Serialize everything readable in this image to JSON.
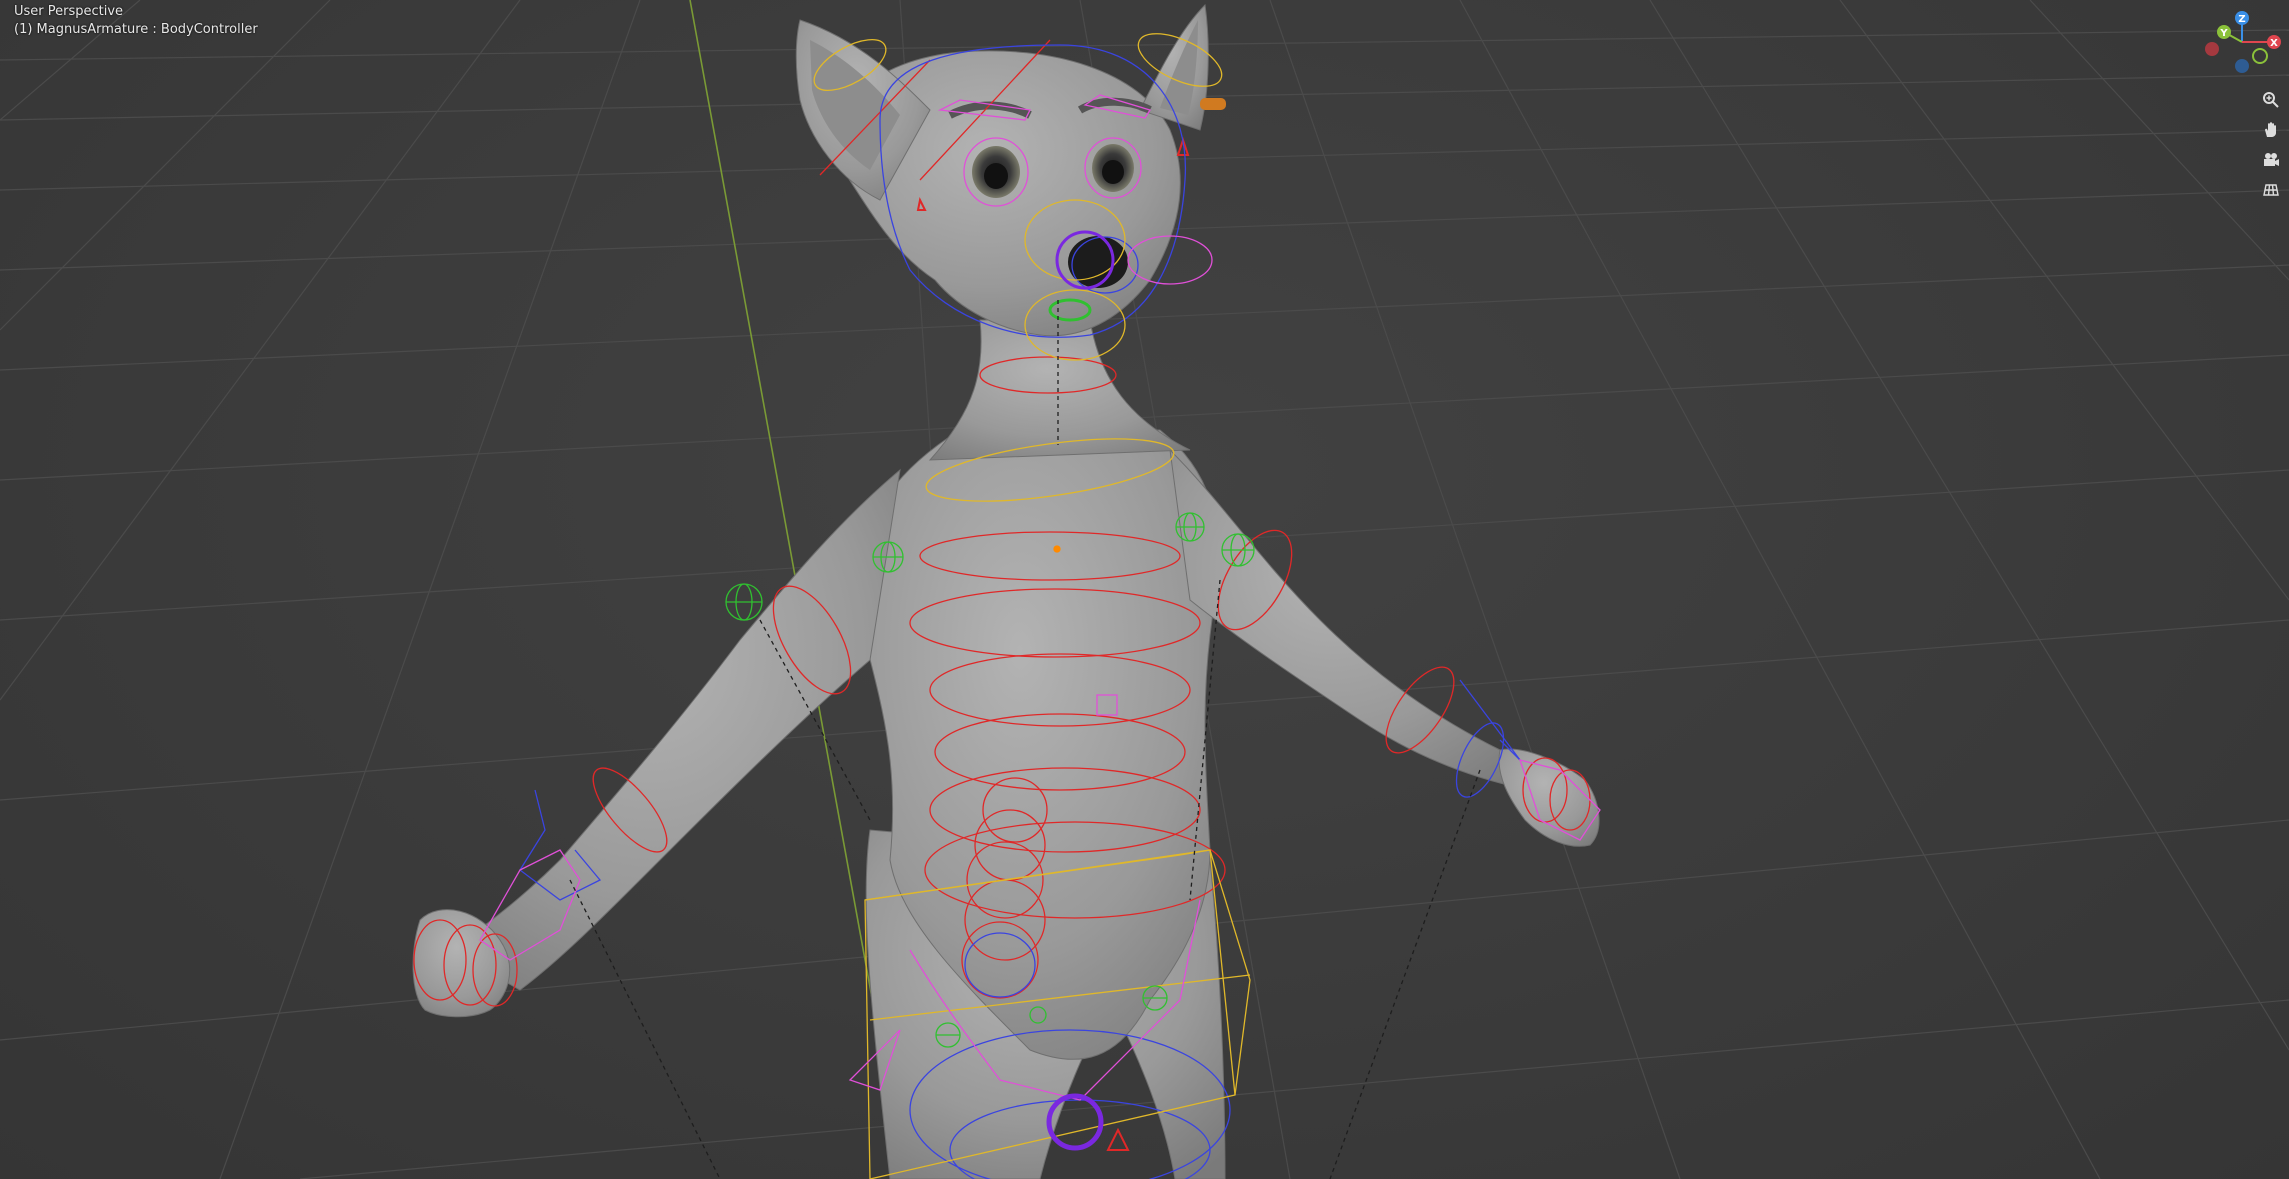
{
  "viewport": {
    "view_name": "User Perspective",
    "active_object": "(1) MagnusArmature : BodyController"
  },
  "gizmo": {
    "z_label": "Z",
    "y_label": "Y",
    "x_label": "X",
    "colors": {
      "x": "#e0464f",
      "y": "#8bc13a",
      "z": "#3a8fe6"
    }
  },
  "nav_buttons": [
    {
      "name": "zoom",
      "icon": "magnifier-plus-icon"
    },
    {
      "name": "pan",
      "icon": "hand-icon"
    },
    {
      "name": "camera",
      "icon": "camera-icon"
    },
    {
      "name": "ortho",
      "icon": "grid-icon"
    }
  ],
  "colors": {
    "background": "#3a3a3a",
    "grid": "#4a4a4a",
    "y_axis": "#7a9a35",
    "bone_red": "#e02828",
    "bone_blue": "#3a44e0",
    "bone_yellow": "#e0b82a",
    "bone_green": "#30c030",
    "bone_pink": "#e050d8",
    "mesh": "#9a9a9a"
  }
}
